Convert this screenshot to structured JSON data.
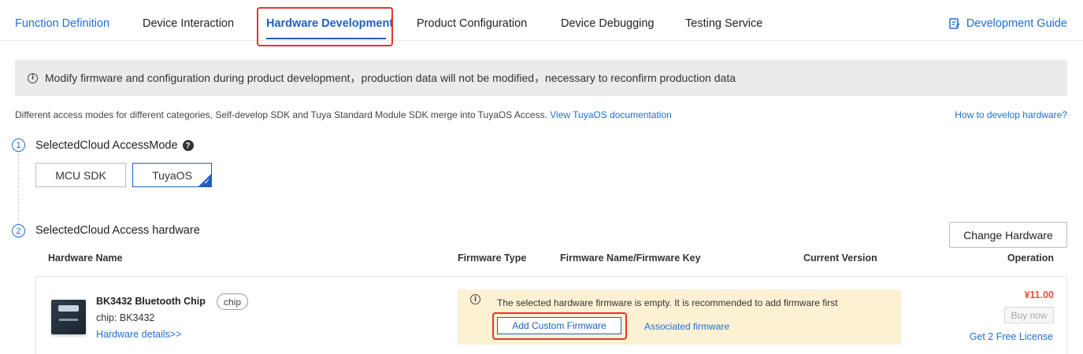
{
  "tabs": [
    {
      "label": "Function Definition"
    },
    {
      "label": "Device Interaction"
    },
    {
      "label": "Hardware Development"
    },
    {
      "label": "Product Configuration"
    },
    {
      "label": "Device Debugging"
    },
    {
      "label": "Testing Service"
    }
  ],
  "active_tab": "Hardware Development",
  "dev_guide": {
    "label": "Development Guide",
    "icon": "guide-icon"
  },
  "notice": {
    "icon": "info-icon",
    "text": "Modify firmware and configuration during product development，production data will not be modified，necessary to reconfirm production data"
  },
  "description": {
    "text": "Different access modes for different categories, Self-develop SDK and Tuya Standard Module SDK merge into TuyaOS Access. ",
    "link": "View TuyaOS documentation"
  },
  "how_link": "How to develop hardware?",
  "step1": {
    "number": "1",
    "title": "SelectedCloud AccessMode",
    "modes": [
      "MCU SDK",
      "TuyaOS"
    ],
    "selected": "TuyaOS"
  },
  "step2": {
    "number": "2",
    "title": "SelectedCloud Access hardware",
    "change_button": "Change Hardware"
  },
  "table": {
    "headers": [
      "Hardware Name",
      "Firmware Type",
      "Firmware Name/Firmware Key",
      "Current Version",
      "Operation"
    ],
    "row": {
      "name": "BK3432 Bluetooth Chip",
      "tag": "chip",
      "chip": "chip: BK3432",
      "details": "Hardware details>>",
      "warning": "The selected hardware firmware is empty. It is recommended to add firmware first",
      "add_button": "Add Custom Firmware",
      "associated": "Associated firmware",
      "price": "¥11.00",
      "buy": "Buy now",
      "free_license": "Get 2 Free License"
    }
  },
  "colors": {
    "accent": "#1f5fbf",
    "link": "#1f6fd1",
    "highlight": "#e8332d",
    "price": "#e8503a",
    "warning_bg": "#fdf1d3"
  }
}
